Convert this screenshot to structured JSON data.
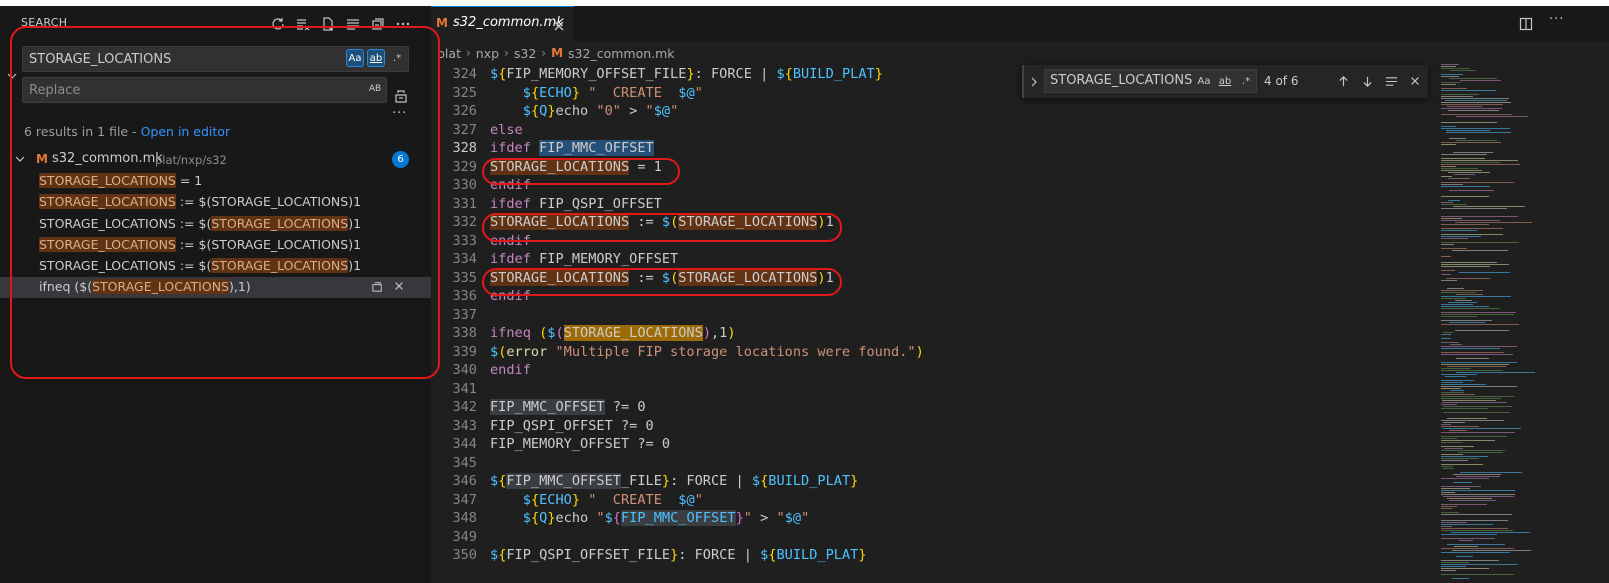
{
  "search_panel": {
    "title": "SEARCH",
    "find_value": "STORAGE_LOCATIONS",
    "replace_placeholder": "Replace",
    "find_options": [
      "Aa",
      "ab",
      ".*"
    ],
    "replace_option": "AB",
    "summary_prefix": "6 results in 1 file - ",
    "summary_link": "Open in editor",
    "file": {
      "name": "s32_common.mk",
      "path": "plat/nxp/s32",
      "count": "6",
      "icon": "M"
    },
    "results": [
      {
        "pre": "",
        "match": "STORAGE_LOCATIONS",
        "post": " = 1",
        "pre_match": false
      },
      {
        "pre": "",
        "match": "STORAGE_LOCATIONS",
        "post": " := $(STORAGE_LOCATIONS)1"
      },
      {
        "pre": "STORAGE_LOCATIONS := $(",
        "match": "STORAGE_LOCATIONS",
        "post": ")1"
      },
      {
        "pre": "",
        "match": "STORAGE_LOCATIONS",
        "post": " := $(STORAGE_LOCATIONS)1"
      },
      {
        "pre": "STORAGE_LOCATIONS := $(",
        "match": "STORAGE_LOCATIONS",
        "post": ")1"
      },
      {
        "pre": "ifneq ($(",
        "match": "STORAGE_LOCATIONS",
        "post": "),1)"
      }
    ]
  },
  "editor": {
    "tab_label": "s32_common.mk",
    "tab_icon": "M",
    "breadcrumb": [
      "plat",
      "nxp",
      "s32",
      "s32_common.mk"
    ],
    "find_widget": {
      "value": "STORAGE_LOCATIONS",
      "options": [
        "Aa",
        "ab",
        ".*"
      ],
      "count": "4 of 6"
    },
    "line_numbers": [
      "324",
      "325",
      "326",
      "327",
      "328",
      "329",
      "330",
      "331",
      "332",
      "333",
      "334",
      "335",
      "336",
      "337",
      "338",
      "339",
      "340",
      "341",
      "342",
      "343",
      "344",
      "345",
      "346",
      "347",
      "348",
      "349",
      "350"
    ]
  },
  "colors": {
    "accent": "#0078d4",
    "match": "#613214",
    "annotation": "#e11818"
  }
}
